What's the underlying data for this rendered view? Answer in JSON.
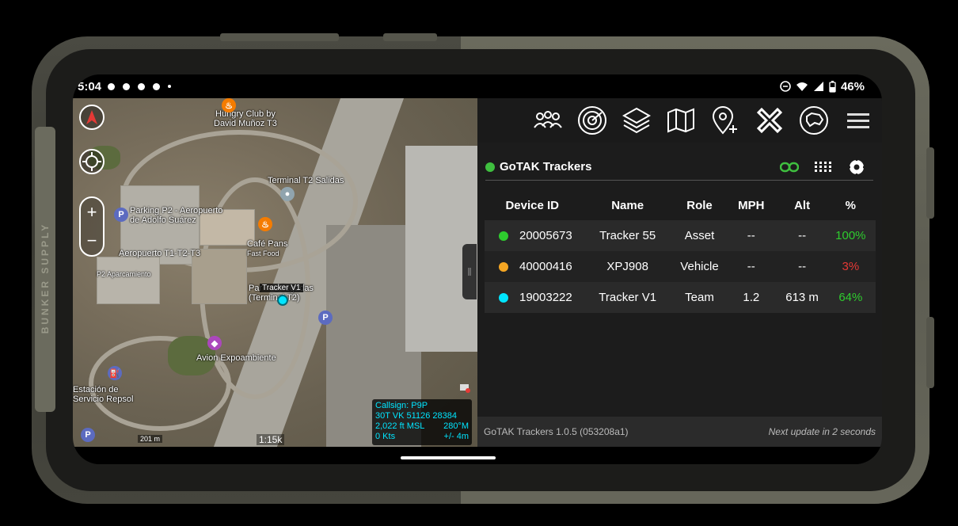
{
  "case": {
    "brand": "BUNKER SUPPLY"
  },
  "status_bar": {
    "time": "5:04",
    "battery": "46%"
  },
  "map": {
    "labels": {
      "hungry_club": "Hungry Club by\nDavid Muñoz T3",
      "terminal_t2_salidas": "Terminal T2 Salidas",
      "parking_p2": "Parking P2 - Aeropuerto\nde Adolfo Suárez",
      "cafe_pans": "Café Pans",
      "fast_food": "Fast Food",
      "aeropuerto_t1": "Aeropuerto T1-T2-T3",
      "p2_aparcamiento": "P2 Aparcamiento",
      "llegadas": "Par     s llegadas\n(Terminal T2)",
      "avion_expoambiente": "Avion Expoambiente",
      "estacion_repsol": "Estación de\nServicio Repsol"
    },
    "tracker_label": "Tracker V1",
    "scale_distance": "201 m",
    "scale_ratio": "1:15k",
    "info": {
      "callsign": "Callsign: P9P",
      "grid_zone": "30T  VK  51126  28384",
      "altitude": "2,022 ft MSL",
      "heading": "280°M",
      "speed": "0 Kts",
      "accuracy": "+/- 4m"
    }
  },
  "panel": {
    "title": "GoTAK Trackers",
    "columns": [
      "Device ID",
      "Name",
      "Role",
      "MPH",
      "Alt",
      "%"
    ],
    "rows": [
      {
        "color": "#2ecc2e",
        "device_id": "20005673",
        "name": "Tracker 55",
        "role": "Asset",
        "mph": "--",
        "alt": "--",
        "pct": "100%",
        "pct_color": "#2ecc2e"
      },
      {
        "color": "#f5a623",
        "device_id": "40000416",
        "name": "XPJ908",
        "role": "Vehicle",
        "mph": "--",
        "alt": "--",
        "pct": "3%",
        "pct_color": "#e53935"
      },
      {
        "color": "#00e5ff",
        "device_id": "19003222",
        "name": "Tracker V1",
        "role": "Team",
        "mph": "1.2",
        "alt": "613 m",
        "pct": "64%",
        "pct_color": "#2ecc2e"
      }
    ],
    "footer_version": "GoTAK Trackers 1.0.5 (053208a1)",
    "footer_update": "Next update in 2 seconds"
  },
  "icons": [
    "contacts-icon",
    "radar-icon",
    "layers-icon",
    "map-icon",
    "add-marker-icon",
    "close-icon",
    "dog-tracker-icon",
    "hamburger-menu-icon",
    "link-icon",
    "grid-icon",
    "gear-icon"
  ]
}
